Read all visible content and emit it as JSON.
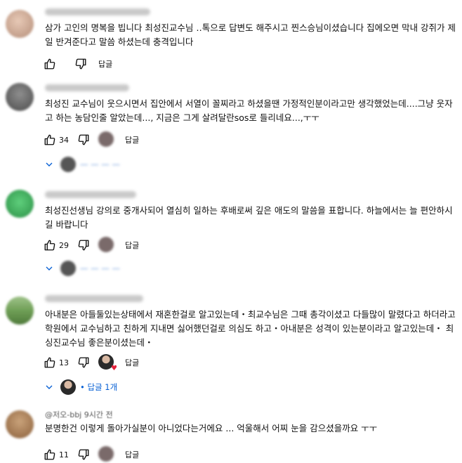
{
  "comments": [
    {
      "author": "",
      "text": "삼가 고인의 명복을 빕니다 최성진교수님 ‥톡으로 답변도 해주시고 찐스승님이셨습니다 집에오면 막내 강쥐가 제일 반겨준다고 말씀  하셨는데 충격입니다",
      "likes": "",
      "reply_label": "답글"
    },
    {
      "author": "",
      "text": "최성진 교수님이 웃으시면서 집안에서 서열이 꼴찌라고 하셨을땐 가정적인분이라고만 생각했었는데....그냥 웃자고 하는 농담인줄 알았는데...,  지금은 그게 살려달란sos로 들리네요...,ㅜㅜ",
      "likes": "34",
      "reply_label": "답글"
    },
    {
      "author": "",
      "text": "최성진선생님 강의로  중개사되어 열심히 일하는  후배로써  깊은 애도의 말씀을 표합니다. 하늘에서는 늘 편안하시길 바랍니다",
      "likes": "29",
      "reply_label": "답글"
    },
    {
      "author": "",
      "text": "아내분은  아들둘있는상태에서   재혼한걸로 알고있는데・최교수님은 그때 총각이셨고 다들많이 말렸다고 하더라고 학원에서  교수님하고 친하게 지내면 싫어했던걸로  의심도 하고・아내분은 성격이 있는분이라고 알고있는데・ 최싱진교수님 좋은분이셨는데・",
      "likes": "13",
      "reply_label": "답글",
      "replies_label": "• 답글 1개"
    },
    {
      "author": "@저오-bbj 9시간 전",
      "text": "분명한건 이렇게 돌아가실분이 아니었다는거에요 ... 억울해서 어찌 눈을 감으셨을까요 ㅜㅜ",
      "likes": "11",
      "reply_label": "답글"
    }
  ],
  "icons": {
    "like": "thumbs-up-icon",
    "dislike": "thumbs-down-icon",
    "expand": "chevron-down-icon",
    "creator_heart": "creator-heart-icon"
  },
  "colors": {
    "text": "#0f0f0f",
    "link": "#065fd4",
    "heart": "#e3213b"
  }
}
